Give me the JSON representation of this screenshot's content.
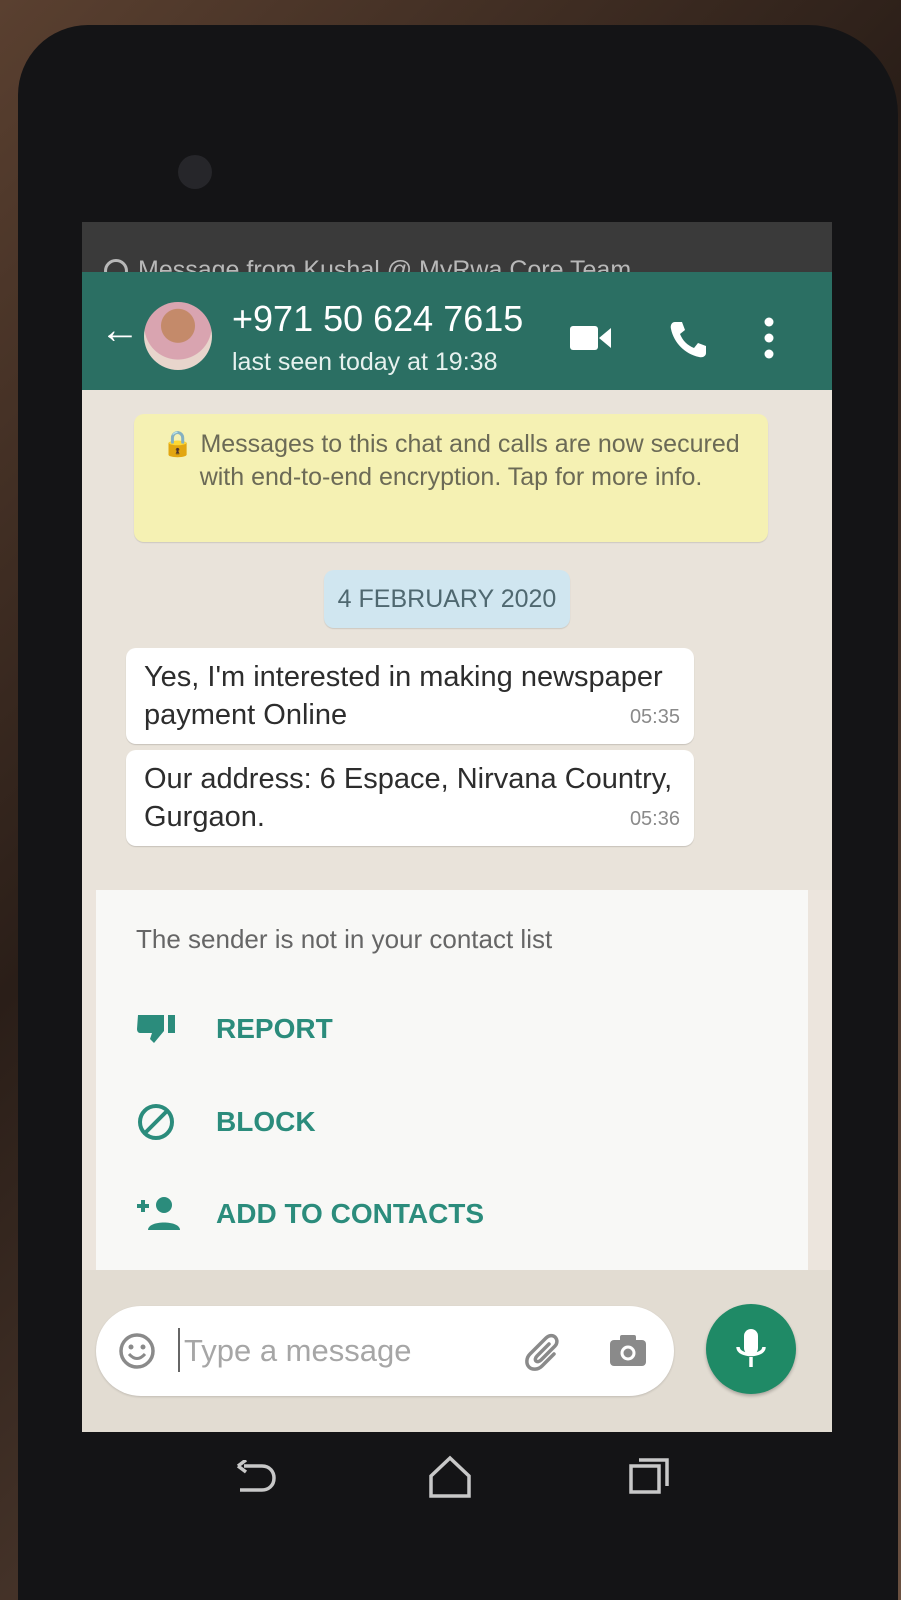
{
  "notification": {
    "text": "Message from Kushal @ MyRwa Core Team"
  },
  "header": {
    "contact_name": "+971 50 624 7615",
    "last_seen": "last seen today at 19:38"
  },
  "chat": {
    "encryption_notice": "🔒 Messages to this chat and calls are now secured with end-to-end encryption. Tap for more info.",
    "date_chip": "4 FEBRUARY 2020",
    "messages": [
      {
        "text": "Yes, I'm interested in making newspaper payment Online",
        "time": "05:35"
      },
      {
        "text": "Our address: 6 Espace, Nirvana Country, Gurgaon.",
        "time": "05:36"
      }
    ]
  },
  "unknown_sender": {
    "notice": "The sender is not in your contact list",
    "actions": [
      {
        "label": "REPORT",
        "icon": "thumbs-down-icon"
      },
      {
        "label": "BLOCK",
        "icon": "block-icon"
      },
      {
        "label": "ADD TO CONTACTS",
        "icon": "add-contact-icon"
      }
    ]
  },
  "input": {
    "placeholder": "Type a message"
  },
  "colors": {
    "header": "#2b6f63",
    "accent": "#2b8c7c",
    "mic": "#1f8a66",
    "encryption_bg": "#f5f1b3",
    "date_chip_bg": "#d0e6f0"
  }
}
